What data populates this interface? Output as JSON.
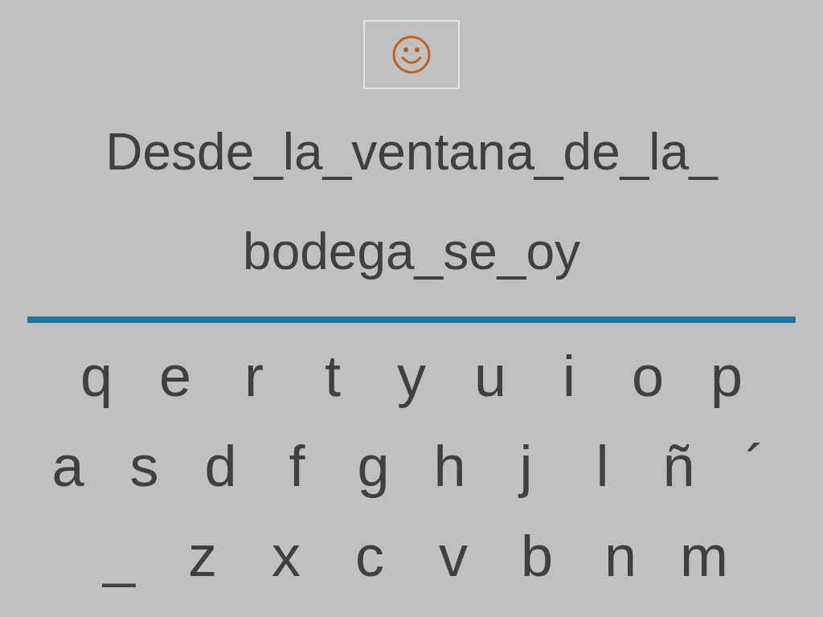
{
  "sentence_lines": [
    "Desde_la_ventana_de_la_",
    "bodega_se_oy"
  ],
  "keyboard_rows": [
    [
      "q",
      "e",
      "r",
      "t",
      "y",
      "u",
      "i",
      "o",
      "p"
    ],
    [
      "a",
      "s",
      "d",
      "f",
      "g",
      "h",
      "j",
      "l",
      "ñ",
      "´"
    ],
    [
      "_",
      "z",
      "x",
      "c",
      "v",
      "b",
      "n",
      "m"
    ]
  ]
}
